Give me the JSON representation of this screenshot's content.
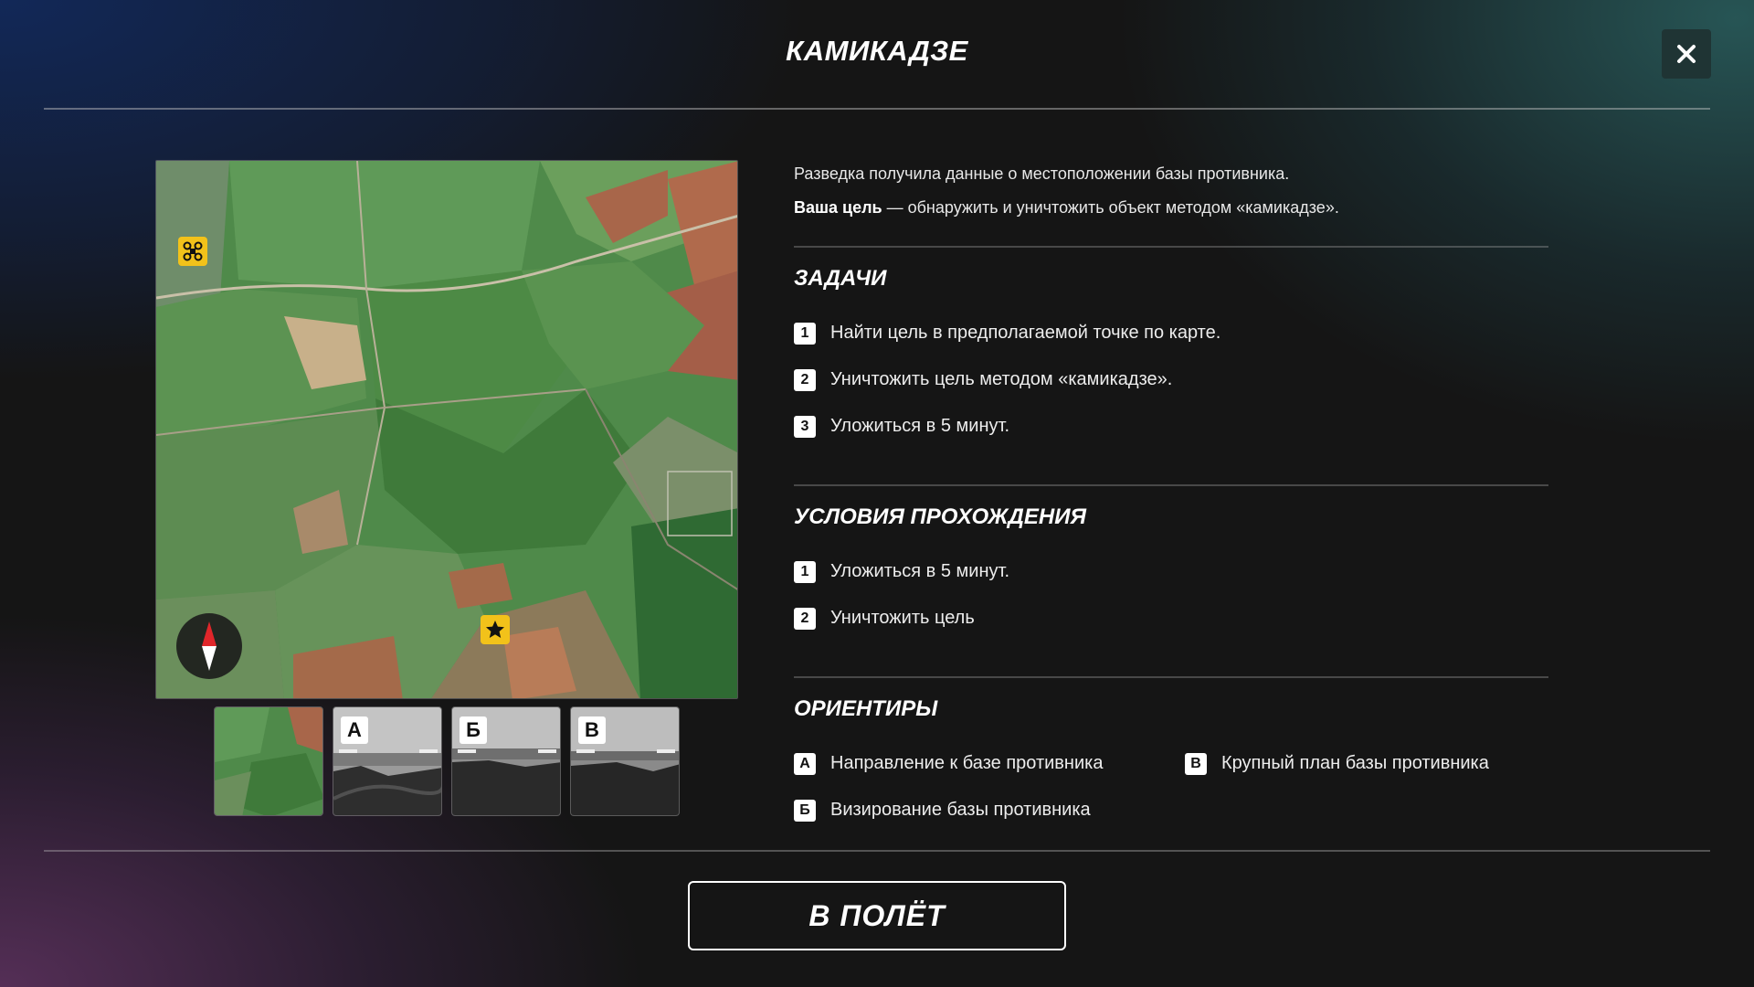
{
  "header": {
    "title": "КАМИКАДЗЕ",
    "close_icon": "close-icon"
  },
  "map": {
    "markers": [
      {
        "name": "drone-icon",
        "color": "#f2c21a"
      },
      {
        "name": "star-icon",
        "color": "#f2c21a"
      }
    ],
    "compass_icon": "compass-icon"
  },
  "thumbnails": [
    {
      "letter": ""
    },
    {
      "letter": "А"
    },
    {
      "letter": "Б"
    },
    {
      "letter": "В"
    }
  ],
  "briefing": {
    "intro_line": "Разведка получила данные о местоположении базы противника.",
    "goal_bold": "Ваша цель",
    "goal_rest": " — обнаружить и уничтожить объект методом «камикадзе»."
  },
  "tasks": {
    "title": "ЗАДАЧИ",
    "items": [
      {
        "num": "1",
        "text": "Найти цель в предполагаемой точке по карте."
      },
      {
        "num": "2",
        "text": "Уничтожить цель методом «камикадзе»."
      },
      {
        "num": "3",
        "text": "Уложиться в 5 минут."
      }
    ]
  },
  "conditions": {
    "title": "УСЛОВИЯ ПРОХОЖДЕНИЯ",
    "items": [
      {
        "num": "1",
        "text": "Уложиться в 5 минут."
      },
      {
        "num": "2",
        "text": "Уничтожить цель"
      }
    ]
  },
  "landmarks": {
    "title": "ОРИЕНТИРЫ",
    "items": [
      {
        "letter": "А",
        "text": "Направление к базе противника"
      },
      {
        "letter": "В",
        "text": "Крупный план базы противника"
      },
      {
        "letter": "Б",
        "text": "Визирование базы противника"
      }
    ]
  },
  "footer": {
    "fly_label": "В ПОЛЁТ"
  }
}
